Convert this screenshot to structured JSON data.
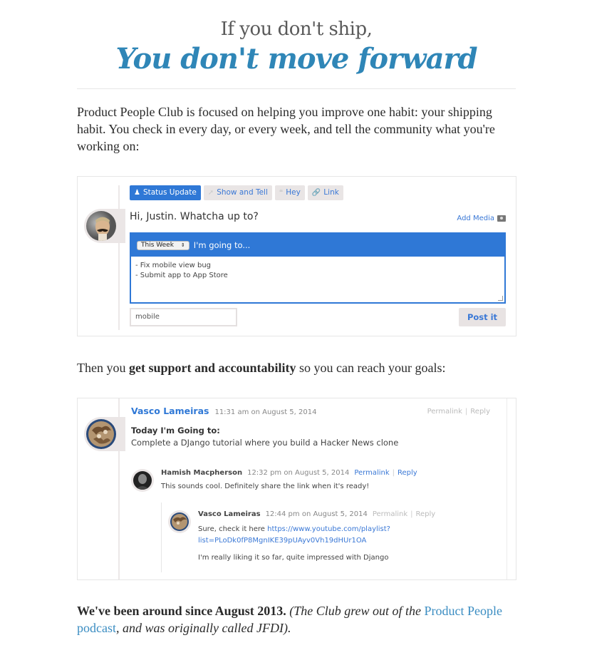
{
  "hero": {
    "subtitle": "If you don't ship,",
    "title": "You don't move forward"
  },
  "intro": {
    "text": "Product People Club is focused on helping you improve one habit: your shipping habit. You check in every day, or every week, and tell the community what you're working on:"
  },
  "compose": {
    "tabs": [
      {
        "label": "Status Update",
        "icon": "user-icon",
        "active": true
      },
      {
        "label": "Show and Tell",
        "icon": "pin-icon",
        "active": false
      },
      {
        "label": "Hey",
        "icon": "quote-icon",
        "active": false
      },
      {
        "label": "Link",
        "icon": "link-icon",
        "active": false
      }
    ],
    "greeting": "Hi, Justin. Whatcha up to?",
    "add_media": "Add Media",
    "period_select": "This Week",
    "prompt": "I'm going to...",
    "text": "- Fix mobile view bug\n- Submit app to App Store",
    "tag_value": "mobile",
    "post_label": "Post it"
  },
  "support": {
    "prefix": "Then you ",
    "bold": "get support and accountability",
    "suffix": " so you can reach your goals:"
  },
  "comments": {
    "main": {
      "author": "Vasco Lameiras",
      "time": "11:31 am on August 5, 2014",
      "permalink": "Permalink",
      "reply": "Reply",
      "title": "Today I'm Going to:",
      "body": "Complete a DJango tutorial where you build a Hacker News clone"
    },
    "reply1": {
      "author": "Hamish Macpherson",
      "time": "12:32 pm on August 5, 2014",
      "permalink": "Permalink",
      "reply": "Reply",
      "body": "This sounds cool. Definitely share the link when it's ready!"
    },
    "reply2": {
      "author": "Vasco Lameiras",
      "time": "12:44 pm on August 5, 2014",
      "permalink": "Permalink",
      "reply": "Reply",
      "body_prefix": "Sure, check it here ",
      "link_line1": "https://www.youtube.com/playlist?",
      "link_line2": "list=PLoDk0fP8MgnIKE39pUAyv0Vh19dHUr1OA",
      "body2": "I'm really liking it so far, quite impressed with Django"
    }
  },
  "history": {
    "bold": "We've been around since August 2013.",
    "italic_prefix": " (The Club grew out of the ",
    "link": "Product People podcast",
    "italic_suffix": ", and was originally called JFDI)."
  },
  "colors": {
    "accent": "#2f78d6",
    "hero_blue": "#2f86b7",
    "link_blue": "#3b8dc2"
  }
}
